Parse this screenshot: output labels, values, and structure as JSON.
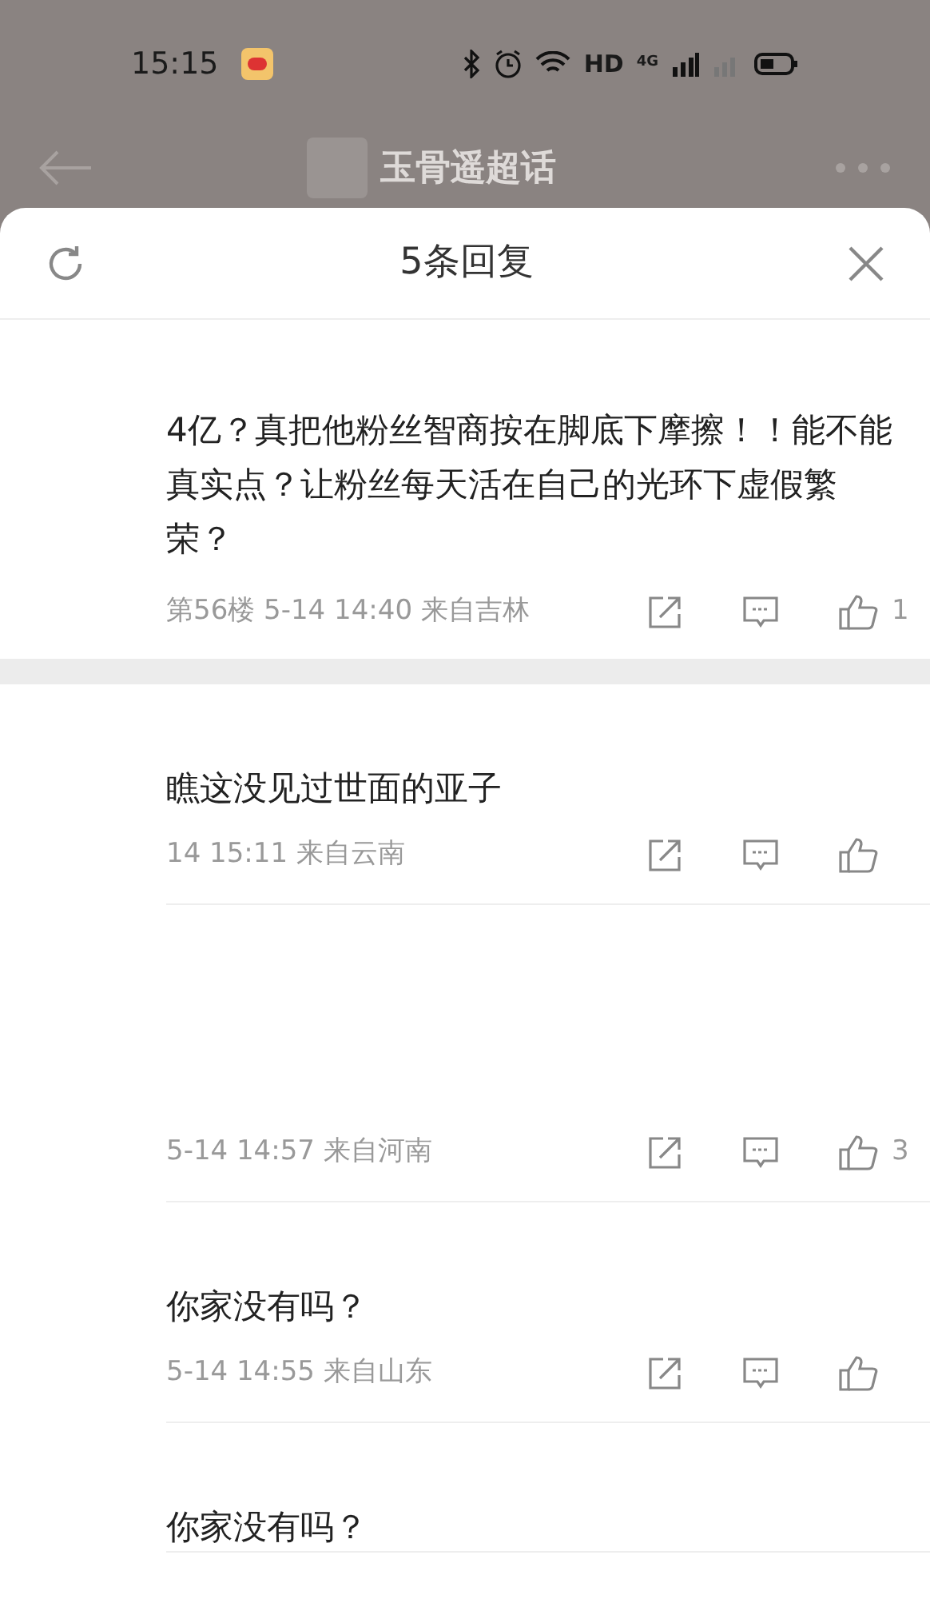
{
  "status_bar": {
    "time": "15:15",
    "network": "HD",
    "signal": "4G"
  },
  "background_header": {
    "title": "玉骨遥超话"
  },
  "sheet": {
    "title": "5条回复"
  },
  "main_comment": {
    "text": "4亿？真把他粉丝智商按在脚底下摩擦！！能不能真实点？让粉丝每天活在自己的光环下虚假繁荣？",
    "meta": "第56楼 5-14 14:40 来自吉林",
    "likes": "1"
  },
  "replies": [
    {
      "text": "瞧这没见过世面的亚子",
      "meta": "14 15:11 来自云南"
    },
    {
      "meta": "5-14 14:57 来自河南",
      "likes": "3"
    },
    {
      "text": "你家没有吗？",
      "meta": "5-14 14:55 来自山东"
    },
    {
      "text": "你家没有吗？"
    }
  ]
}
